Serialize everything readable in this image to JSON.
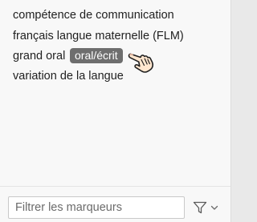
{
  "tags": [
    {
      "label": "compétence de communication"
    },
    {
      "label": "français langue maternelle (FLM)"
    },
    {
      "label": "grand oral"
    },
    {
      "label": "variation de la langue"
    }
  ],
  "highlighted_tag": {
    "label": "oral/écrit"
  },
  "filter": {
    "placeholder": "Filtrer les marqueurs",
    "value": ""
  },
  "icons": {
    "cursor": "hand-pointer-icon",
    "filter": "funnel-icon",
    "dropdown": "chevron-down-icon"
  },
  "colors": {
    "panel_bg": "#f8f8f8",
    "chip_bg": "#6e6e6e",
    "chip_text": "#ffffff",
    "text": "#1f1f1f"
  }
}
